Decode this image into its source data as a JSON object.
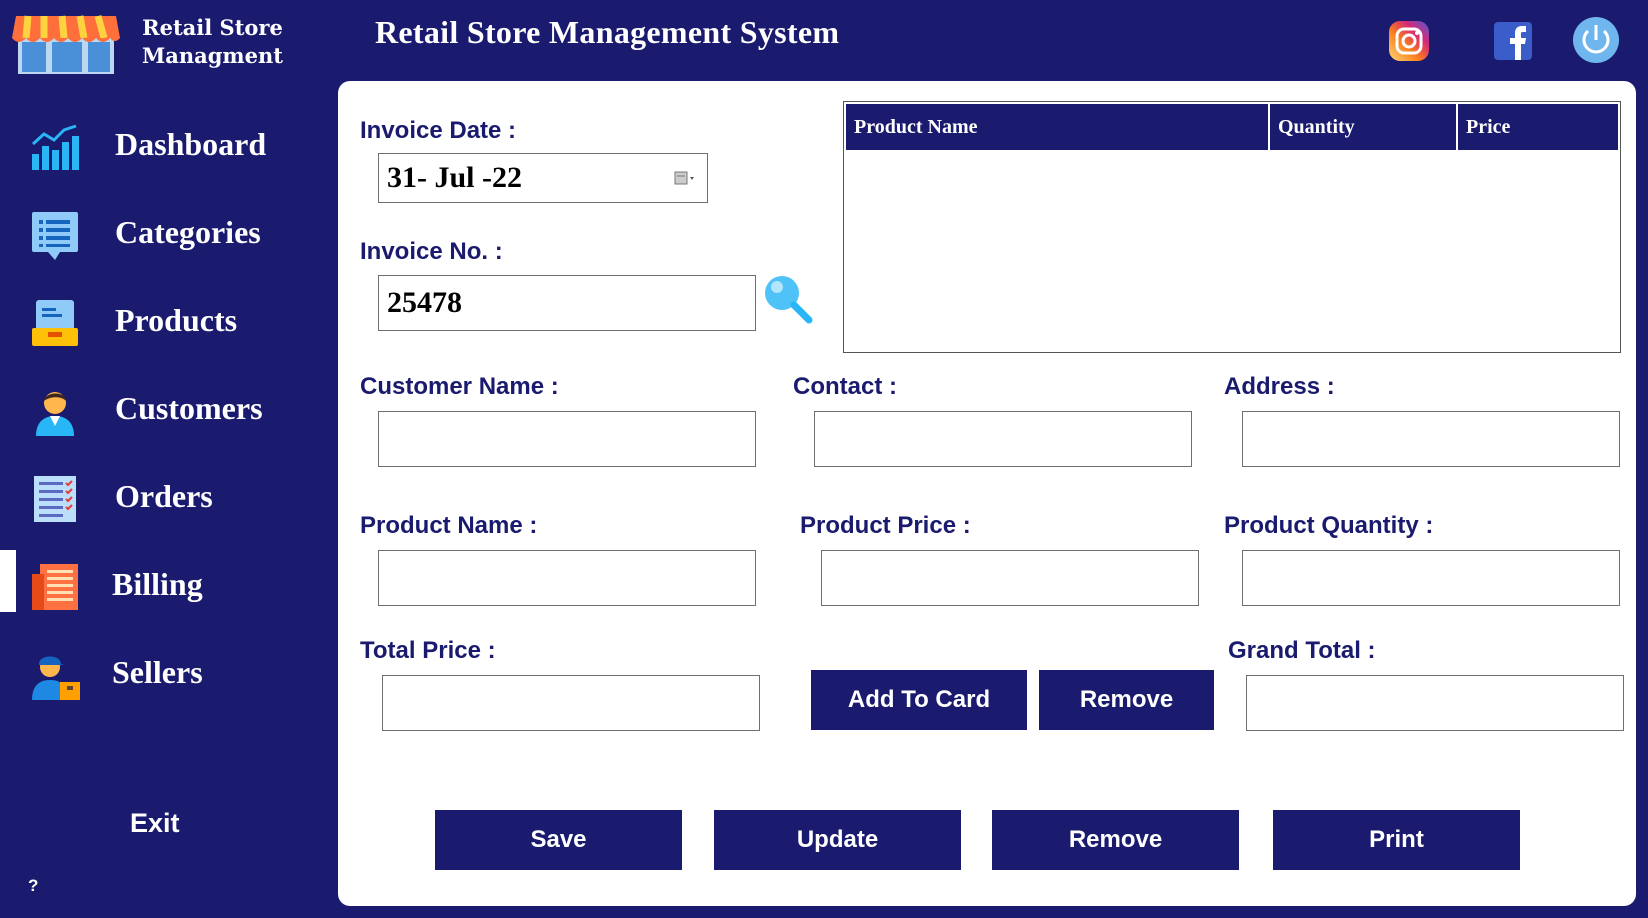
{
  "brand": {
    "line1": "Retail Store",
    "line2": "Managment"
  },
  "header": {
    "title": "Retail Store Management System"
  },
  "social": {
    "instagram": "instagram-icon",
    "facebook": "facebook-icon",
    "power": "power-icon"
  },
  "sidebar": {
    "items": [
      {
        "label": "Dashboard",
        "icon": "dashboard-chart-icon"
      },
      {
        "label": "Categories",
        "icon": "categories-list-icon"
      },
      {
        "label": "Products",
        "icon": "products-box-icon"
      },
      {
        "label": "Customers",
        "icon": "customer-person-icon"
      },
      {
        "label": "Orders",
        "icon": "orders-checklist-icon"
      },
      {
        "label": "Billing",
        "icon": "billing-receipt-icon",
        "active": true
      },
      {
        "label": "Sellers",
        "icon": "seller-person-icon"
      }
    ],
    "exit_label": "Exit",
    "help_label": "?"
  },
  "form": {
    "invoice_date_label": "Invoice Date :",
    "invoice_date_value": "31- Jul -22",
    "invoice_no_label": "Invoice No. :",
    "invoice_no_value": "25478",
    "customer_name_label": "Customer Name :",
    "contact_label": "Contact :",
    "address_label": "Address :",
    "product_name_label": "Product Name :",
    "product_price_label": "Product Price :",
    "product_quantity_label": "Product Quantity :",
    "total_price_label": "Total Price :",
    "grand_total_label": "Grand Total :"
  },
  "table": {
    "columns": [
      "Product Name",
      "Quantity",
      "Price"
    ],
    "rows": []
  },
  "buttons": {
    "add_to_card": "Add To Card",
    "remove_item": "Remove",
    "save": "Save",
    "update": "Update",
    "remove": "Remove",
    "print": "Print"
  },
  "colors": {
    "primary": "#1a1a6e",
    "panel": "#ffffff",
    "accent_icon": "#4fc3f7"
  }
}
